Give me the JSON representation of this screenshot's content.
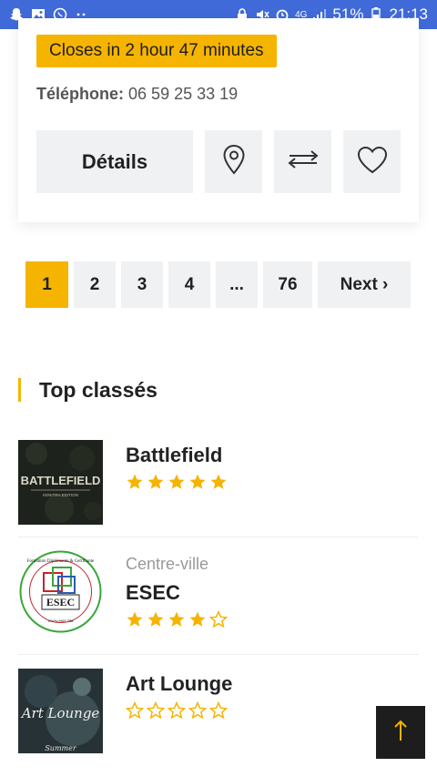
{
  "statusbar": {
    "signal_text": "4G",
    "battery_text": "51%",
    "time": "21:13",
    "left_icons": [
      "snapchat-icon",
      "image-icon",
      "whatsapp-icon",
      "dots-icon"
    ],
    "right_icons": [
      "lock-icon",
      "mute-icon",
      "alarm-icon",
      "signal-icon",
      "battery-icon"
    ]
  },
  "listing": {
    "closes_label": "Closes in 2 hour 47 minutes",
    "phone_label": "Téléphone:",
    "phone_value": "06 59 25 33 19",
    "details_label": "Détails"
  },
  "pagination": {
    "pages": [
      "1",
      "2",
      "3",
      "4",
      "...",
      "76"
    ],
    "active": "1",
    "next_label": "Next ›"
  },
  "top_section": {
    "title": "Top classés",
    "items": [
      {
        "category": "",
        "name": "Battlefield",
        "rating": 5,
        "thumb_text": "BATTLEFIELD",
        "thumb_subtext": "KENITRA EDITION"
      },
      {
        "category": "Centre-ville",
        "name": "ESEC",
        "rating": 4,
        "thumb_text": "ESEC",
        "thumb_subtext": "www.esec.ma",
        "thumb_ring_text": "Formation Diplômante & Certifiante"
      },
      {
        "category": "",
        "name": "Art Lounge",
        "rating": 0,
        "thumb_text": "Art Lounge",
        "thumb_subtext": "Summer"
      }
    ]
  },
  "colors": {
    "accent": "#f5b400",
    "statusbar": "#3f6ad8",
    "button_bg": "#f0f1f3",
    "scroll_button": "#1d1d1d"
  }
}
